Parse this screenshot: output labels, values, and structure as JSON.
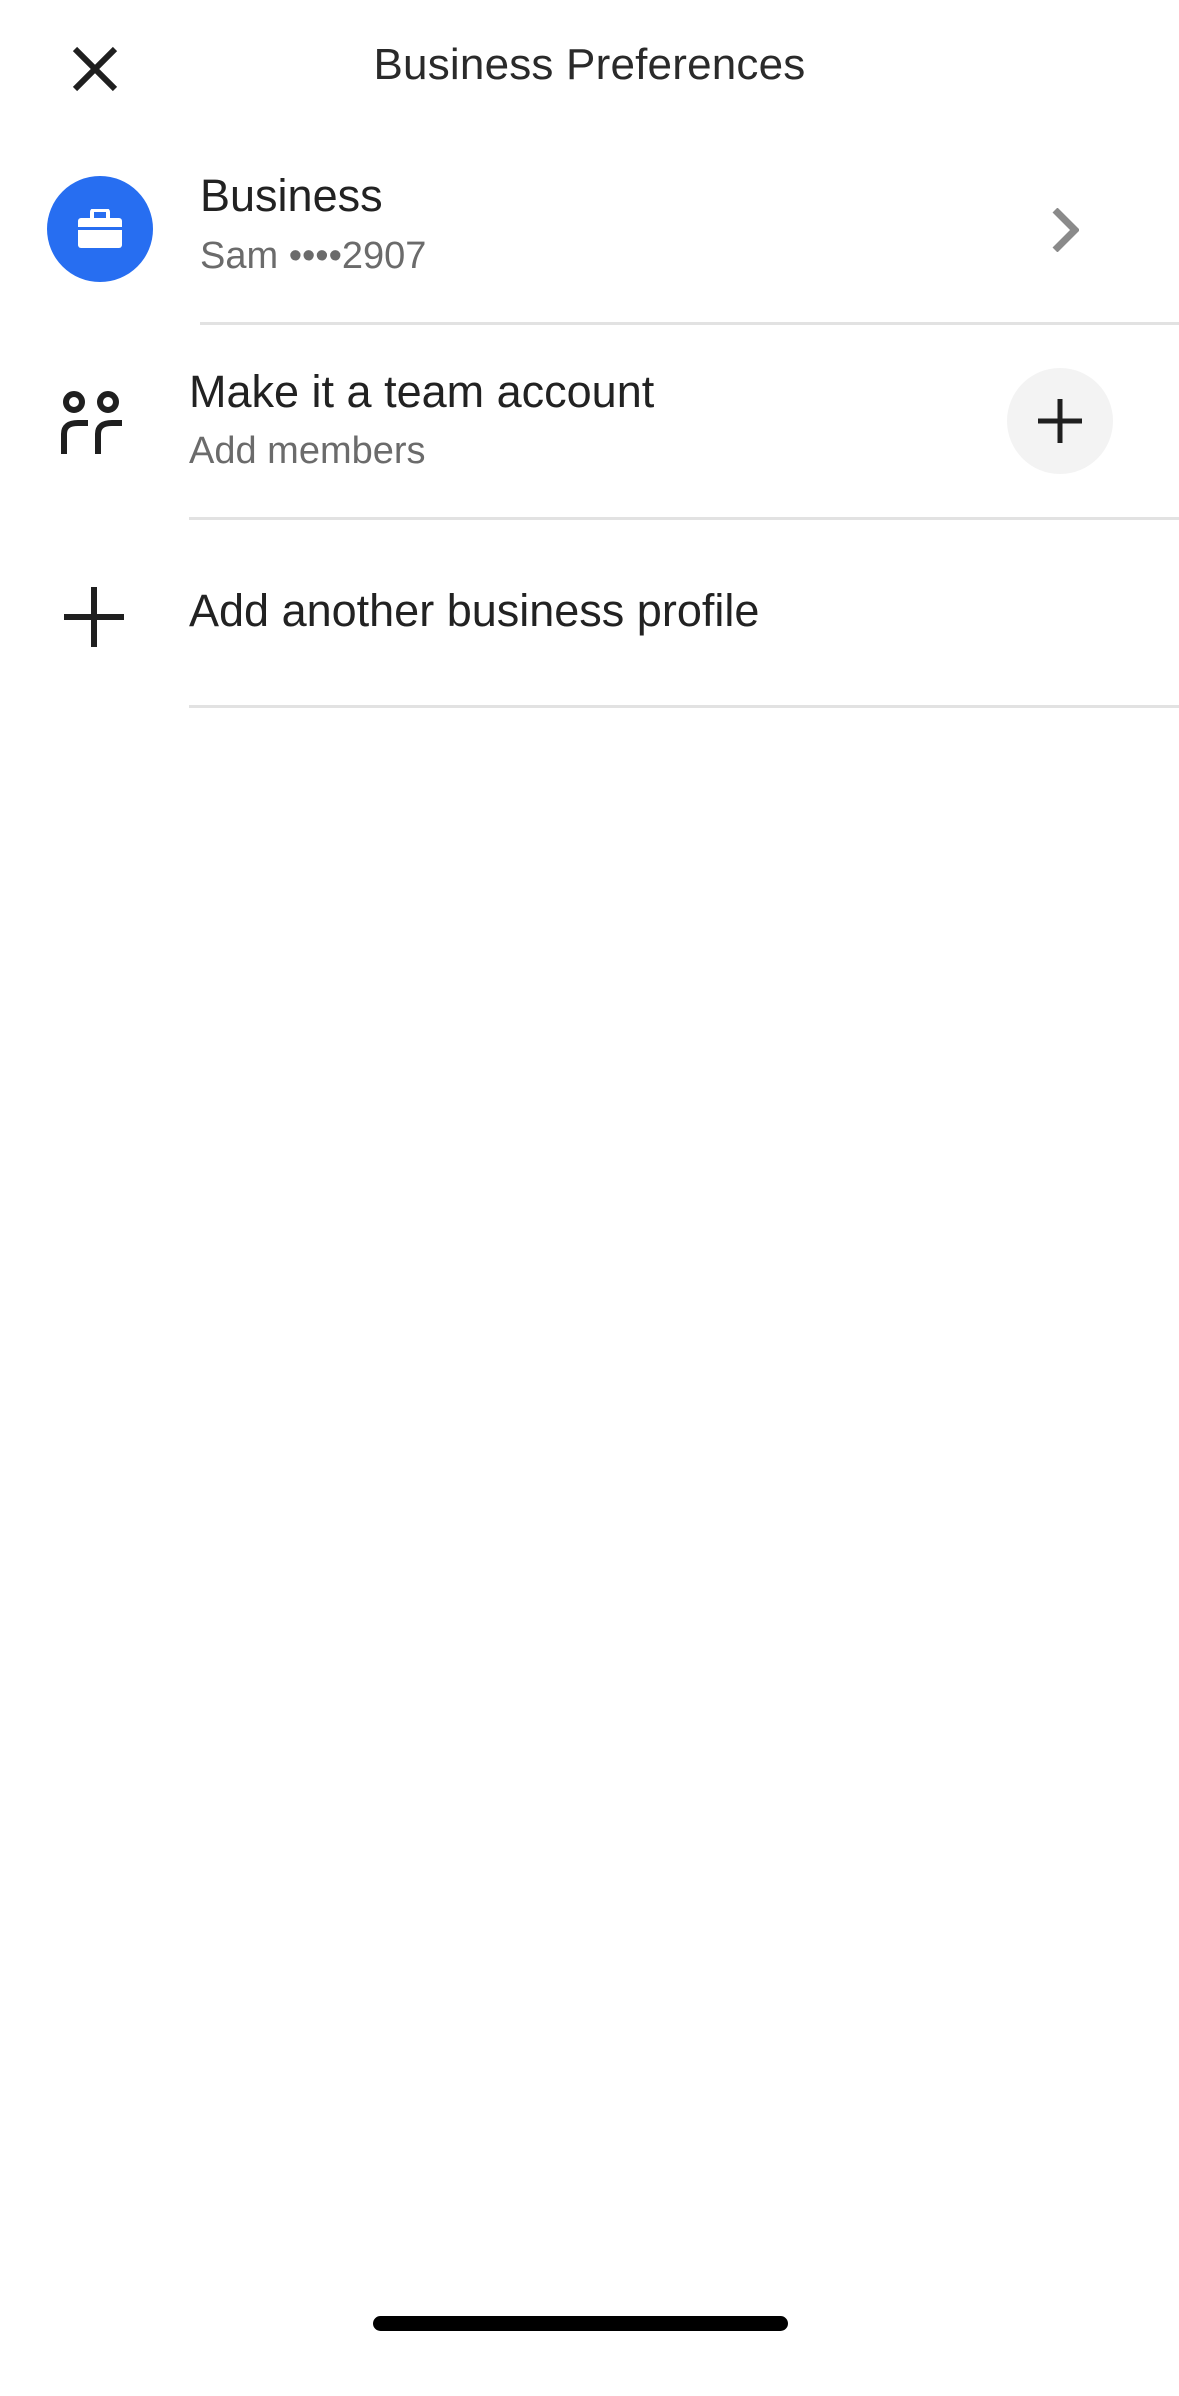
{
  "header": {
    "title": "Business Preferences",
    "close_icon": "close-icon"
  },
  "profile": {
    "icon": "briefcase-icon",
    "title": "Business",
    "subtitle": "Sam ••••2907",
    "chevron_icon": "chevron-right-icon",
    "accent_color": "#276ef1"
  },
  "team": {
    "icon": "people-icon",
    "title": "Make it a team account",
    "subtitle": "Add members",
    "button_icon": "plus-icon"
  },
  "add_profile": {
    "icon": "plus-icon",
    "label": "Add another business profile"
  }
}
